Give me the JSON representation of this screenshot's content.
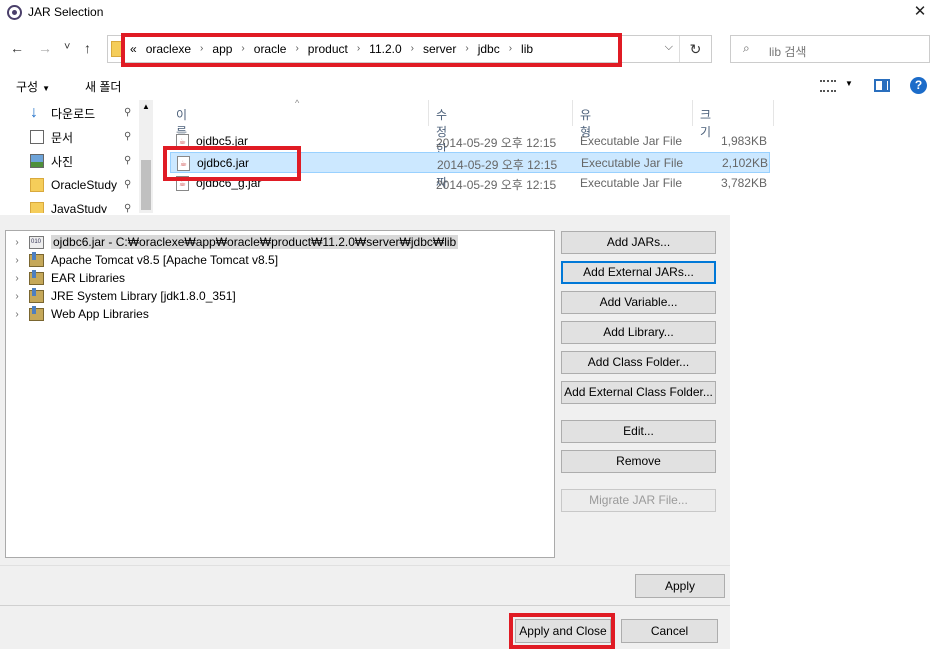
{
  "dialog": {
    "title": "JAR Selection",
    "close_glyph": "✕",
    "nav": {
      "back": "←",
      "forward": "→",
      "recent": "˅",
      "up": "↑"
    },
    "address": {
      "overflow": "«",
      "crumbs": [
        "oraclexe",
        "app",
        "oracle",
        "product",
        "11.2.0",
        "server",
        "jdbc",
        "lib"
      ],
      "separator": "›",
      "dropdown": "⌵",
      "refresh": "↻"
    },
    "search": {
      "icon": "⌕",
      "placeholder": "lib 검색"
    },
    "toolbar": {
      "organize": "구성",
      "organize_caret": "▼",
      "new_folder": "새 폴더",
      "view_caret": "▼",
      "help": "?"
    },
    "nav_pane": {
      "items": [
        {
          "label": "다운로드",
          "icon": "download-icon",
          "pinned": true
        },
        {
          "label": "문서",
          "icon": "document-icon",
          "pinned": true
        },
        {
          "label": "사진",
          "icon": "pictures-icon",
          "pinned": true
        },
        {
          "label": "OracleStudy",
          "icon": "folder-icon",
          "pinned": true
        },
        {
          "label": "JavaStudy",
          "icon": "folder-icon",
          "pinned": true
        }
      ],
      "pin_glyph": "📌"
    },
    "columns": {
      "name": "이름",
      "modified": "수정한 날짜",
      "type": "유형",
      "size": "크기",
      "sort_glyph": "^"
    },
    "files": [
      {
        "name": "ojdbc5.jar",
        "modified": "2014-05-29 오후 12:15",
        "type": "Executable Jar File",
        "size": "1,983KB",
        "selected": false
      },
      {
        "name": "ojdbc6.jar",
        "modified": "2014-05-29 오후 12:15",
        "type": "Executable Jar File",
        "size": "2,102KB",
        "selected": true
      },
      {
        "name": "ojdbc6_g.jar",
        "modified": "2014-05-29 오후 12:15",
        "type": "Executable Jar File",
        "size": "3,782KB",
        "selected": false
      }
    ]
  },
  "build_path": {
    "tree": [
      {
        "label": "ojdbc6.jar - C:₩oraclexe₩app₩oracle₩product₩11.2.0₩server₩jdbc₩lib",
        "icon": "jar-icon",
        "selected": true
      },
      {
        "label": "Apache Tomcat v8.5 [Apache Tomcat v8.5]",
        "icon": "library-icon",
        "selected": false
      },
      {
        "label": "EAR Libraries",
        "icon": "library-icon",
        "selected": false
      },
      {
        "label": "JRE System Library [jdk1.8.0_351]",
        "icon": "library-icon",
        "selected": false
      },
      {
        "label": "Web App Libraries",
        "icon": "library-icon",
        "selected": false
      }
    ],
    "expand_glyph": "›",
    "buttons": [
      {
        "label": "Add JARs...",
        "state": "normal"
      },
      {
        "label": "Add External JARs...",
        "state": "focused"
      },
      {
        "label": "Add Variable...",
        "state": "normal"
      },
      {
        "label": "Add Library...",
        "state": "normal"
      },
      {
        "label": "Add Class Folder...",
        "state": "normal"
      },
      {
        "label": "Add External Class Folder...",
        "state": "normal"
      },
      {
        "label": "Edit...",
        "state": "normal"
      },
      {
        "label": "Remove",
        "state": "normal"
      },
      {
        "label": "Migrate JAR File...",
        "state": "disabled"
      }
    ],
    "apply": "Apply",
    "apply_and_close": "Apply and Close",
    "cancel": "Cancel"
  },
  "colors": {
    "highlight": "#e01b24",
    "selection": "#cce8ff",
    "focus": "#0078d7"
  }
}
